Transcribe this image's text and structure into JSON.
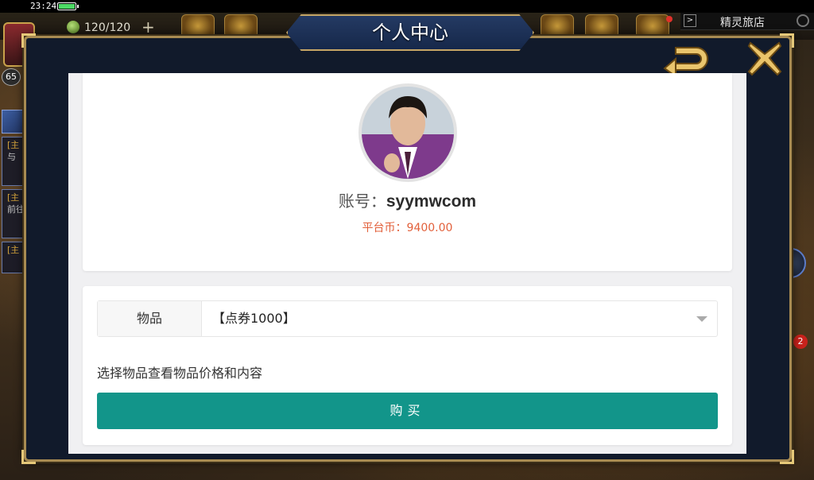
{
  "status": {
    "time": "23:24"
  },
  "hud": {
    "energy": "120/120",
    "level": "65"
  },
  "shop": {
    "label": "精灵旅店",
    "arrow": ">"
  },
  "quests": [
    {
      "tag": "[主",
      "sub": "与"
    },
    {
      "tag": "[主",
      "sub": "前往"
    },
    {
      "tag": "[主",
      "sub": ""
    }
  ],
  "side": {
    "badge_count": "2"
  },
  "modal": {
    "title": "个人中心"
  },
  "profile": {
    "account_label": "账号：",
    "account_value": "syymwcom",
    "coin_text": "平台币：9400.00"
  },
  "purchase": {
    "item_label": "物品",
    "selected_item": "【点券1000】",
    "hint": "选择物品查看物品价格和内容",
    "buy_label": "购买"
  },
  "colors": {
    "buy_button": "#12958a",
    "coin_text": "#e2603b",
    "modal_border": "#a88b52"
  },
  "icons": [
    "battery-icon",
    "energy-icon",
    "plus-icon",
    "search-icon",
    "back-arrow-icon",
    "close-x-icon",
    "chevron-down-icon"
  ]
}
